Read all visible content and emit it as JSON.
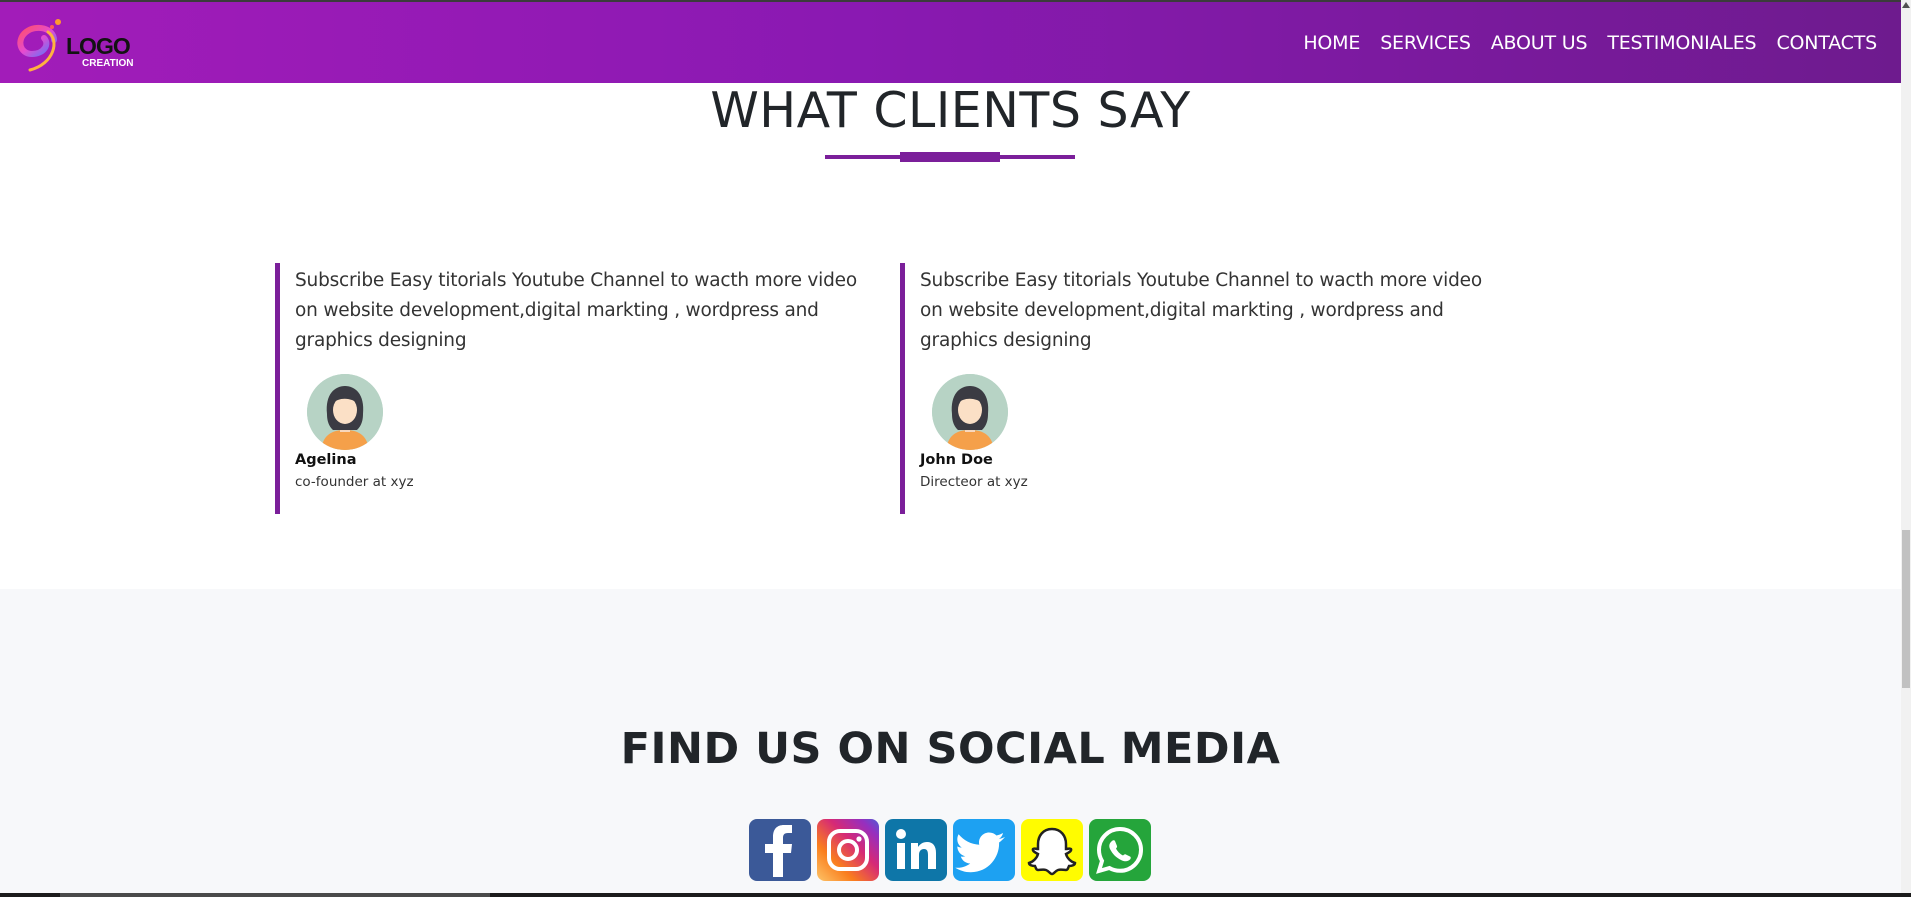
{
  "brand": {
    "logo_word": "LOGO",
    "logo_sub": "CREATION"
  },
  "nav": {
    "items": [
      {
        "label": "HOME"
      },
      {
        "label": "SERVICES"
      },
      {
        "label": "ABOUT US"
      },
      {
        "label": "TESTIMONIALES"
      },
      {
        "label": "CONTACTS"
      }
    ]
  },
  "testimonials": {
    "title": "WHAT CLIENTS SAY",
    "items": [
      {
        "quote": "Subscribe Easy titorials Youtube Channel to wacth more video on website development,digital markting , wordpress and graphics designing",
        "name": "Agelina",
        "role": "co-founder at xyz"
      },
      {
        "quote": "Subscribe Easy titorials Youtube Channel to wacth more video on website development,digital markting , wordpress and graphics designing",
        "name": "John Doe",
        "role": "Directeor at xyz"
      }
    ]
  },
  "social": {
    "title": "FIND US ON SOCIAL MEDIA",
    "icons": [
      "facebook-icon",
      "instagram-icon",
      "linkedin-icon",
      "twitter-icon",
      "snapchat-icon",
      "whatsapp-icon"
    ]
  },
  "colors": {
    "nav_gradient_start": "#a21cb9",
    "nav_gradient_end": "#6e1b8e",
    "accent": "#7b1f9a",
    "social_bg": "#f7f8fa"
  }
}
